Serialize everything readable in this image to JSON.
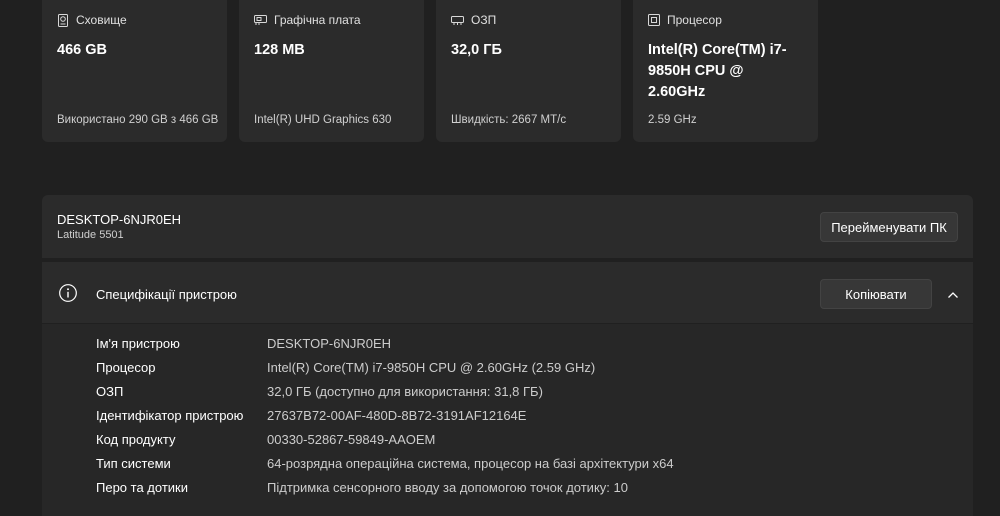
{
  "cards": [
    {
      "title": "Сховище",
      "icon": "storage-icon",
      "value": "466 GB",
      "sub": "Використано 290 GB з 466 GB"
    },
    {
      "title": "Графічна плата",
      "icon": "graphics-card-icon",
      "value": "128 MB",
      "sub": "Intel(R) UHD Graphics 630"
    },
    {
      "title": "ОЗП",
      "icon": "ram-icon",
      "value": "32,0 ГБ",
      "sub": "Швидкість: 2667 МТ/с"
    },
    {
      "title": "Процесор",
      "icon": "processor-icon",
      "value": "Intel(R) Core(TM) i7-9850H CPU @ 2.60GHz",
      "sub": "2.59 GHz"
    }
  ],
  "device": {
    "name": "DESKTOP-6NJR0EH",
    "model": "Latitude 5501",
    "rename_label": "Перейменувати ПК"
  },
  "specs": {
    "title": "Специфікації пристрою",
    "copy_label": "Копіювати",
    "rows": [
      {
        "label": "Ім'я пристрою",
        "value": "DESKTOP-6NJR0EH"
      },
      {
        "label": "Процесор",
        "value": "Intel(R) Core(TM) i7-9850H CPU @ 2.60GHz (2.59 GHz)"
      },
      {
        "label": "ОЗП",
        "value": "32,0 ГБ (доступно для використання: 31,8 ГБ)"
      },
      {
        "label": "Ідентифікатор пристрою",
        "value": "27637B72-00AF-480D-8B72-3191AF12164E"
      },
      {
        "label": "Код продукту",
        "value": "00330-52867-59849-AAOEM"
      },
      {
        "label": "Тип системи",
        "value": "64-розрядна операційна система, процесор на базі архітектури x64"
      },
      {
        "label": "Перо та дотики",
        "value": "Підтримка сенсорного вводу за допомогою точок дотику: 10"
      }
    ]
  }
}
